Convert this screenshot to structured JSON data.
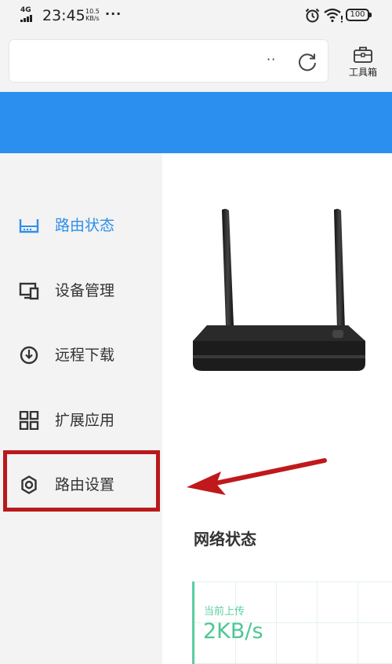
{
  "status_bar": {
    "network": "4G",
    "time": "23:45",
    "speed_value": "10.5",
    "speed_unit": "KB/s",
    "more": "···",
    "battery": "100",
    "icons": [
      "signal-icon",
      "alarm-icon",
      "wifi-icon",
      "battery-icon"
    ]
  },
  "address_bar": {
    "url": "",
    "more": "··",
    "refresh_icon": "refresh-icon"
  },
  "toolbox": {
    "label": "工具箱",
    "icon": "toolbox-icon"
  },
  "sidebar": {
    "items": [
      {
        "label": "路由状态",
        "icon": "router-status-icon",
        "active": true
      },
      {
        "label": "设备管理",
        "icon": "device-management-icon",
        "active": false
      },
      {
        "label": "远程下载",
        "icon": "remote-download-icon",
        "active": false
      },
      {
        "label": "扩展应用",
        "icon": "extensions-icon",
        "active": false
      },
      {
        "label": "路由设置",
        "icon": "settings-gear-icon",
        "active": false
      }
    ]
  },
  "main": {
    "section_title": "网络状态",
    "upload_label": "当前上传",
    "upload_value": "2KB/s"
  },
  "colors": {
    "accent_blue": "#2b8ff0",
    "active_text": "#2f8fea",
    "highlight_red": "#b9191b",
    "stat_green": "#4cc795"
  }
}
